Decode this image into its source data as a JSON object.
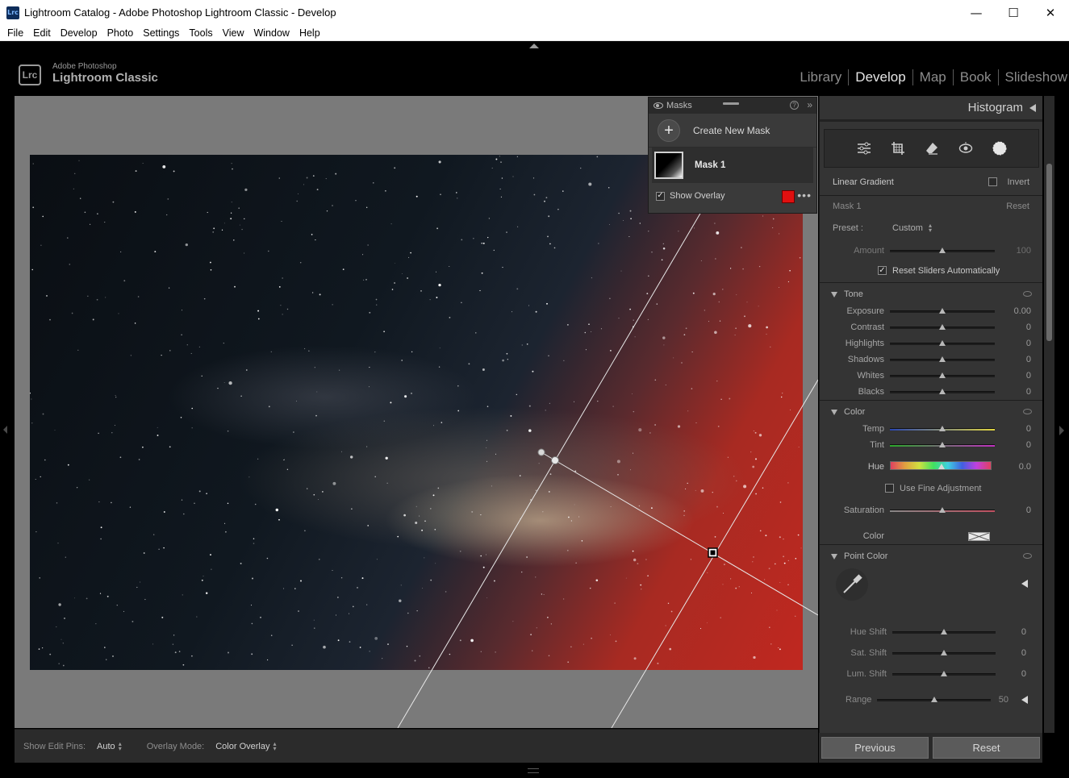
{
  "window": {
    "app_icon": "Lrc",
    "title": "Lightroom Catalog - Adobe Photoshop Lightroom Classic - Develop",
    "minimize": "—",
    "maximize": "☐",
    "close": "✕"
  },
  "menu": [
    "File",
    "Edit",
    "Develop",
    "Photo",
    "Settings",
    "Tools",
    "View",
    "Window",
    "Help"
  ],
  "brand": {
    "logo": "Lrc",
    "line1": "Adobe Photoshop",
    "line2": "Lightroom Classic"
  },
  "modules": [
    "Library",
    "Develop",
    "Map",
    "Book",
    "Slideshow"
  ],
  "active_module": "Develop",
  "masks_panel": {
    "title": "Masks",
    "help": "?",
    "collapse": "»",
    "create_label": "Create New Mask",
    "mask_name": "Mask 1",
    "show_overlay_label": "Show Overlay",
    "show_overlay_checked": true,
    "overlay_color": "#e01010",
    "more": "•••"
  },
  "bottom_toolbar": {
    "edit_pins_label": "Show Edit Pins:",
    "edit_pins_value": "Auto",
    "overlay_mode_label": "Overlay Mode:",
    "overlay_mode_value": "Color Overlay"
  },
  "right_panel": {
    "histogram_title": "Histogram",
    "tools": [
      "sliders-icon",
      "crop-icon",
      "eraser-icon",
      "redeye-icon",
      "mask-icon"
    ],
    "mask_type": "Linear Gradient",
    "invert_label": "Invert",
    "mask_label": "Mask 1",
    "reset_label": "Reset",
    "preset_label": "Preset :",
    "preset_value": "Custom",
    "amount_label": "Amount",
    "amount_value": "100",
    "amount_pos": 0.5,
    "reset_sliders_label": "Reset Sliders Automatically",
    "tone": {
      "title": "Tone",
      "sliders": [
        {
          "label": "Exposure",
          "value": "0.00",
          "pos": 0.5
        },
        {
          "label": "Contrast",
          "value": "0",
          "pos": 0.5
        },
        {
          "label": "Highlights",
          "value": "0",
          "pos": 0.5
        },
        {
          "label": "Shadows",
          "value": "0",
          "pos": 0.5
        },
        {
          "label": "Whites",
          "value": "0",
          "pos": 0.5
        },
        {
          "label": "Blacks",
          "value": "0",
          "pos": 0.5
        }
      ]
    },
    "color": {
      "title": "Color",
      "temp_label": "Temp",
      "temp_value": "0",
      "tint_label": "Tint",
      "tint_value": "0",
      "hue_label": "Hue",
      "hue_value": "0.0",
      "fine_adjust_label": "Use Fine Adjustment",
      "saturation_label": "Saturation",
      "saturation_value": "0",
      "color_label": "Color"
    },
    "point_color": {
      "title": "Point Color",
      "hue_shift_label": "Hue Shift",
      "hue_shift_value": "0",
      "sat_shift_label": "Sat. Shift",
      "sat_shift_value": "0",
      "lum_shift_label": "Lum. Shift",
      "lum_shift_value": "0",
      "range_label": "Range",
      "range_value": "50"
    }
  },
  "nav": {
    "previous": "Previous",
    "reset": "Reset"
  }
}
